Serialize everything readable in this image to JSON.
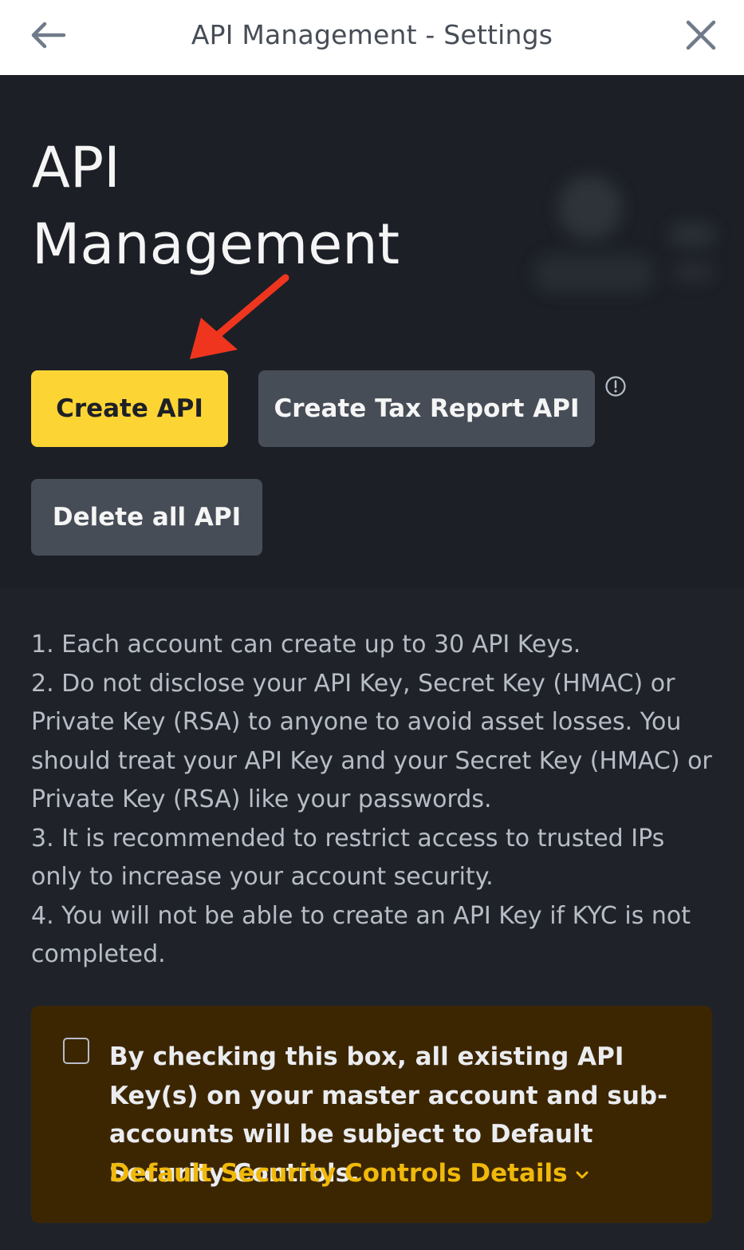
{
  "header": {
    "title": "API Management - Settings",
    "back_icon": "arrow-left-icon",
    "close_icon": "close-icon"
  },
  "hero": {
    "title_line1": "API",
    "title_line2": "Management"
  },
  "actions": {
    "create_api": "Create API",
    "create_tax_report_api": "Create Tax Report API",
    "delete_all_api": "Delete all API",
    "info_icon": "info-circle-icon"
  },
  "notes": [
    "1. Each account can create up to 30 API Keys.",
    "2. Do not disclose your API Key, Secret Key (HMAC) or Private Key (RSA) to anyone to avoid asset losses. You should treat your API Key and your Secret Key (HMAC) or Private Key (RSA) like your passwords.",
    "3. It is recommended to restrict access to trusted IPs only to increase your account security.",
    "4. You will not be able to create an API Key if KYC is not completed."
  ],
  "notice": {
    "checked": false,
    "text": "By checking this box, all existing API Key(s) on your master account and sub-accounts will be subject to Default Security Controls.",
    "link": "Default Security Controls Details"
  },
  "colors": {
    "primary": "#fcd535",
    "link": "#f0b90b",
    "background": "#1f2329",
    "annotation_arrow": "#f0351f"
  }
}
